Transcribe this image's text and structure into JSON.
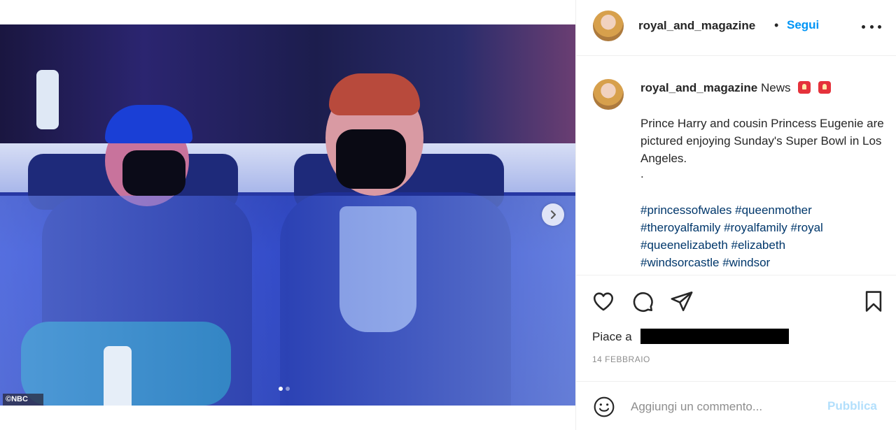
{
  "post": {
    "username": "royal_and_magazine",
    "follow_label": "Segui",
    "dot_separator": "•"
  },
  "media": {
    "watermark": "©NBC",
    "carousel": {
      "total_slides": 2,
      "active_slide": 1
    }
  },
  "caption": {
    "username": "royal_and_magazine",
    "title": "News",
    "body": "Prince Harry and cousin Princess Eugenie are pictured enjoying Sunday's Super Bowl in Los Angeles.",
    "separator": ".",
    "hashtags": [
      "#princessofwales",
      "#queenmother",
      "#theroyalfamily",
      "#royalfamily",
      "#royal",
      "#queenelizabeth",
      "#elizabeth",
      "#windsorcastle",
      "#windsor"
    ]
  },
  "engagement": {
    "likes_prefix": "Piace a",
    "date": "14 FEBBRAIO"
  },
  "comment_bar": {
    "placeholder": "Aggiungi un commento...",
    "publish_label": "Pubblica"
  },
  "icons": {
    "like": "heart-icon",
    "comment": "comment-bubble-icon",
    "share": "paper-plane-icon",
    "save": "bookmark-icon",
    "emoji": "smiley-icon",
    "more": "more-options-icon",
    "next": "chevron-right-icon",
    "caption_emoji": "police-light-emoji"
  },
  "colors": {
    "accent": "#0095f6",
    "hashtag": "#00376b",
    "publish_disabled": "#b2dffc",
    "text": "#262626",
    "muted": "#8e8e8e"
  }
}
